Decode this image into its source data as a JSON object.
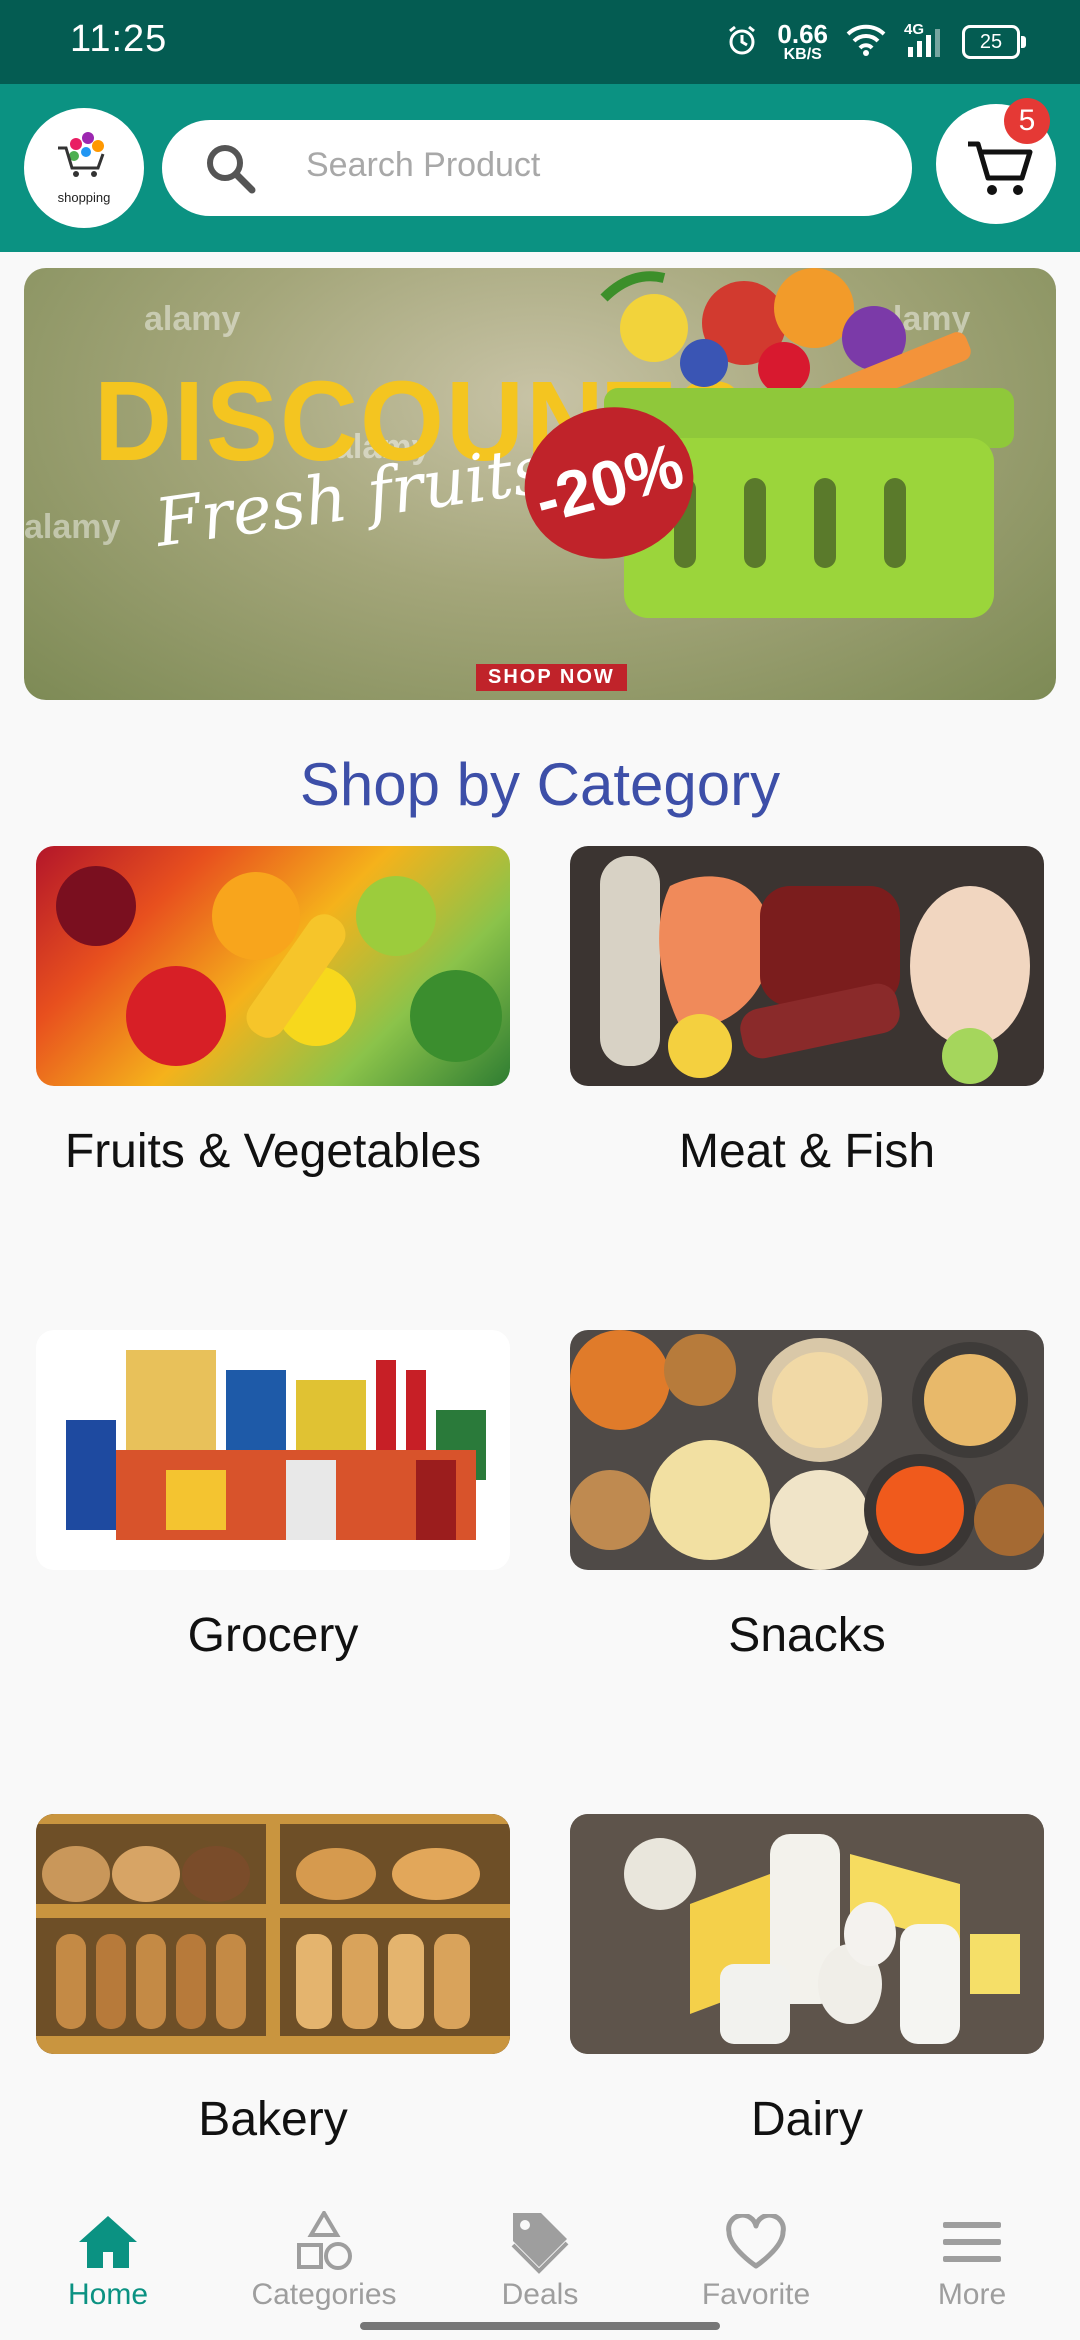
{
  "status_bar": {
    "time": "11:25",
    "speed_value": "0.66",
    "speed_unit": "KB/S",
    "network": "4G",
    "battery": "25"
  },
  "header": {
    "logo_text": "shopping",
    "search_placeholder": "Search Product",
    "cart_count": "5"
  },
  "banner": {
    "title": "DISCOUNTS",
    "subtitle": "Fresh fruits",
    "discount": "-20%",
    "cta": "SHOP NOW",
    "watermark": "alamy"
  },
  "section_title": "Shop by Category",
  "categories": [
    {
      "label": "Fruits & Vegetables"
    },
    {
      "label": "Meat & Fish"
    },
    {
      "label": "Grocery"
    },
    {
      "label": "Snacks"
    },
    {
      "label": "Bakery"
    },
    {
      "label": "Dairy"
    }
  ],
  "nav": [
    {
      "label": "Home",
      "icon": "home-icon",
      "active": true
    },
    {
      "label": "Categories",
      "icon": "shapes-icon",
      "active": false
    },
    {
      "label": "Deals",
      "icon": "tag-icon",
      "active": false
    },
    {
      "label": "Favorite",
      "icon": "heart-icon",
      "active": false
    },
    {
      "label": "More",
      "icon": "menu-icon",
      "active": false
    }
  ],
  "colors": {
    "header": "#0b9282",
    "status_bar": "#045c52",
    "accent_title": "#3d4fa8",
    "badge": "#e53935"
  }
}
